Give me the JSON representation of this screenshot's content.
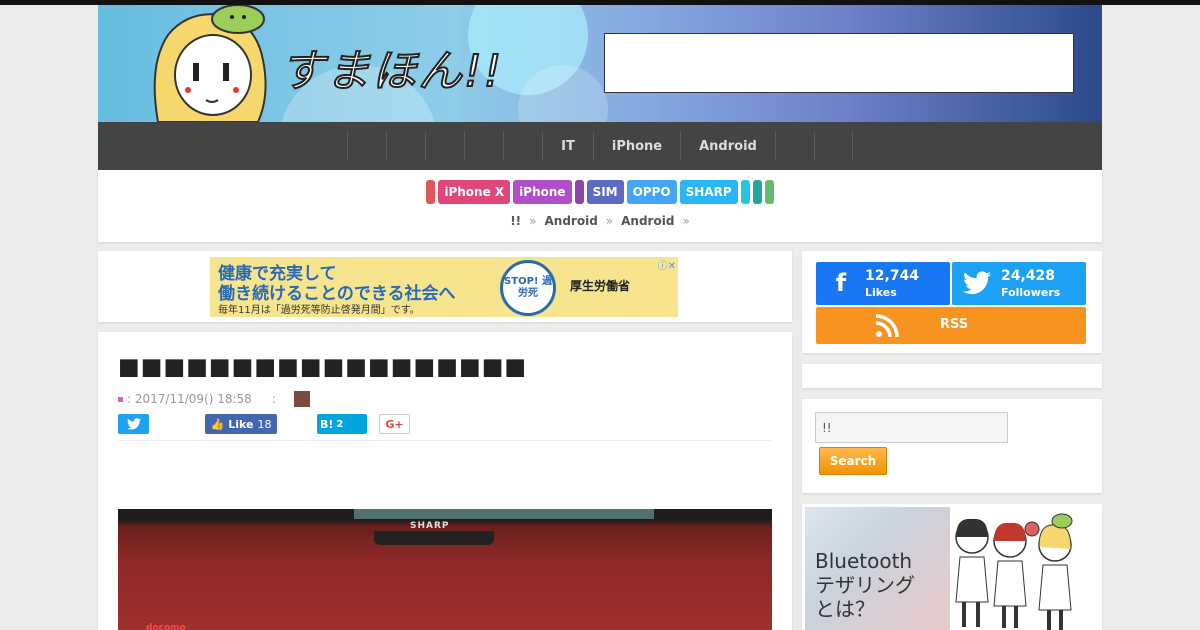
{
  "header": {
    "logo_text": "すまほん!!"
  },
  "nav": {
    "items": [
      "",
      "",
      "",
      "",
      "",
      "IT",
      "iPhone",
      "Android",
      "",
      ""
    ]
  },
  "tags": [
    {
      "label": "",
      "color": "#e05555"
    },
    {
      "label": "iPhone X",
      "color": "#e0457b"
    },
    {
      "label": "iPhone",
      "color": "#b04fc8"
    },
    {
      "label": "",
      "color": "#8e44ad"
    },
    {
      "label": "SIM",
      "color": "#5c6bc0"
    },
    {
      "label": "OPPO",
      "color": "#42a5f5"
    },
    {
      "label": "SHARP",
      "color": "#29b6f6"
    },
    {
      "label": "",
      "color": "#26c6da"
    },
    {
      "label": "",
      "color": "#26a69a"
    },
    {
      "label": "",
      "color": "#66bb6a"
    }
  ],
  "breadcrumb": {
    "items": [
      "!!",
      "Android",
      "Android"
    ],
    "separator": "»"
  },
  "ad_banner": {
    "line1": "健康で充実して",
    "line2": "働き続けることのできる社会へ",
    "line3": "毎年11月は「過労死等防止啓発月間」です。",
    "stop_text": "STOP!\n過労死",
    "ministry": "厚生労働省"
  },
  "article": {
    "title": "■■■■■■■■■■■■■■■■■■",
    "date": ": 2017/11/09() 18:58",
    "author_sep": ":",
    "photo_brand": "SHARP",
    "photo_carrier": "docomo"
  },
  "share": {
    "fb_like_label": "Like",
    "fb_like_count": "18",
    "hatena_label": "B!",
    "hatena_count": "2",
    "gplus_label": "G+"
  },
  "social": {
    "facebook_count": "12,744",
    "facebook_label": "Likes",
    "twitter_count": "24,428",
    "twitter_label": "Followers",
    "rss_label": "RSS"
  },
  "search": {
    "value": "!!",
    "button_label": "Search"
  },
  "promo": {
    "line1": "Bluetooth",
    "line2": "テザリング",
    "line3": "とは？"
  }
}
